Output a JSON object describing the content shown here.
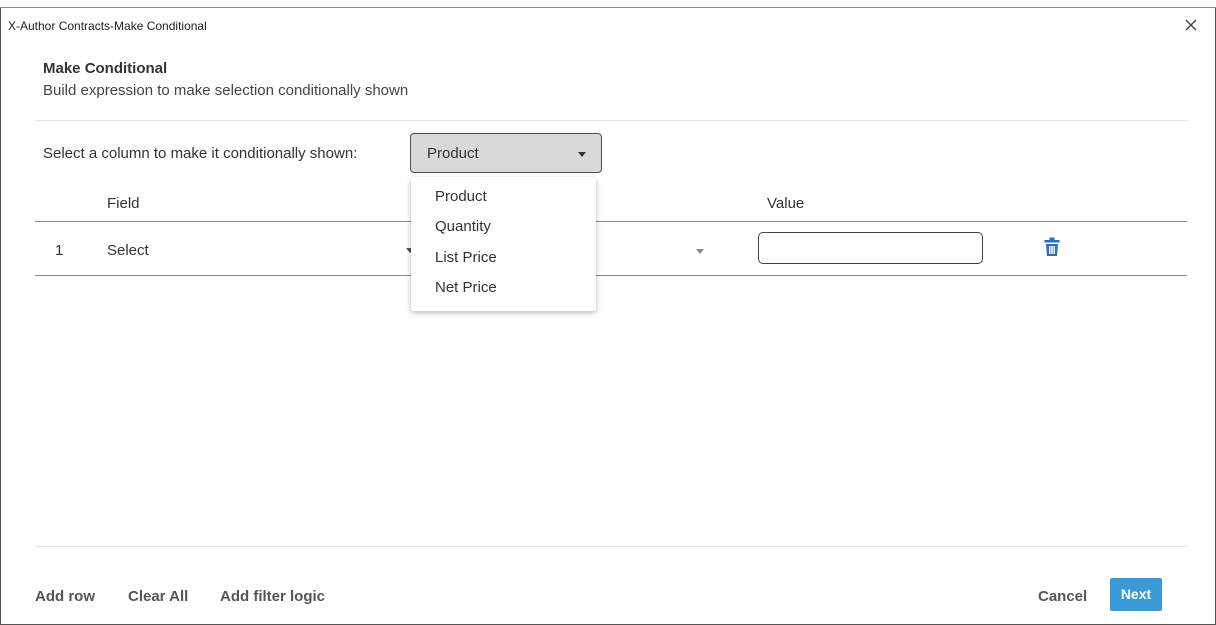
{
  "window": {
    "title": "X-Author Contracts-Make Conditional"
  },
  "header": {
    "title": "Make Conditional",
    "subtitle": "Build expression to make selection conditionally shown"
  },
  "column_select": {
    "label": "Select a column to make it conditionally shown:",
    "selected": "Product",
    "options": [
      "Product",
      "Quantity",
      "List Price",
      "Net Price"
    ],
    "expanded": true
  },
  "table": {
    "columns": {
      "field": "Field",
      "value": "Value"
    },
    "rows": [
      {
        "number": "1",
        "field": "Select",
        "operator": "",
        "value": ""
      }
    ]
  },
  "footer": {
    "add_row": "Add row",
    "clear_all": "Clear All",
    "add_filter_logic": "Add filter logic",
    "cancel": "Cancel",
    "next": "Next"
  },
  "colors": {
    "primary_button": "#3a9ad9",
    "delete_icon": "#2a6ebb",
    "select_background": "#d9d9d9"
  },
  "icons": {
    "close": "close-icon",
    "delete": "trash-icon",
    "dropdown": "caret-down-icon"
  }
}
